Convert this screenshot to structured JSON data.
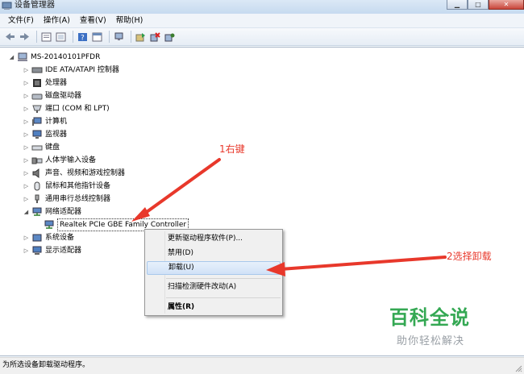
{
  "window": {
    "title": "设备管理器"
  },
  "menu": [
    "文件(F)",
    "操作(A)",
    "查看(V)",
    "帮助(H)"
  ],
  "toolbar": {
    "icons": [
      "back-icon",
      "forward-icon",
      "properties-icon",
      "list-icon",
      "help-icon",
      "console-icon",
      "update-driver-icon",
      "disable-icon",
      "uninstall-icon",
      "scan-icon"
    ]
  },
  "tree": {
    "root": "MS-20140101PFDR",
    "categories": [
      "IDE ATA/ATAPI 控制器",
      "处理器",
      "磁盘驱动器",
      "端口 (COM 和 LPT)",
      "计算机",
      "监视器",
      "键盘",
      "人体学输入设备",
      "声音、视频和游戏控制器",
      "鼠标和其他指针设备",
      "通用串行总线控制器",
      "网络适配器",
      "系统设备",
      "显示适配器"
    ],
    "child": "Realtek PCIe GBE Family Controller"
  },
  "context_menu": {
    "update": "更新驱动程序软件(P)...",
    "disable": "禁用(D)",
    "uninstall": "卸载(U)",
    "scan": "扫描检测硬件改动(A)",
    "properties": "属性(R)"
  },
  "annotations": {
    "step1": "1右键",
    "step2": "2选择卸载",
    "color": "#e8382b"
  },
  "watermark": {
    "main": "百科全说",
    "sub": "助你轻松解决"
  },
  "status": "为所选设备卸载驱动程序。"
}
